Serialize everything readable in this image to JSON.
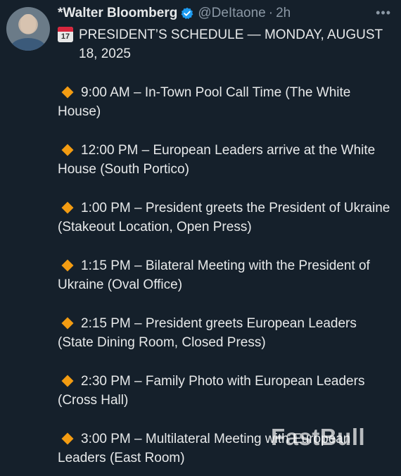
{
  "tweet": {
    "author_name": "*Walter Bloomberg",
    "handle": "@DeItaone",
    "separator": "·",
    "time": "2h",
    "more_label": "•••",
    "calendar_number": "17",
    "title": "PRESIDENT’S SCHEDULE — MONDAY, AUGUST 18, 2025",
    "items": [
      {
        "text": "9:00 AM – In-Town Pool Call Time (The White House)"
      },
      {
        "text": "12:00 PM – European Leaders arrive at the White House (South Portico)"
      },
      {
        "text": "1:00 PM – President greets the President of Ukraine (Stakeout Location, Open Press)"
      },
      {
        "text": "1:15 PM – Bilateral Meeting with the President of Ukraine (Oval Office)"
      },
      {
        "text": "2:15 PM – President greets European Leaders (State Dining Room, Closed Press)"
      },
      {
        "text": "2:30 PM – Family Photo with European Leaders (Cross Hall)"
      },
      {
        "text": "3:00 PM – Multilateral Meeting with European Leaders (East Room)"
      }
    ],
    "watermark": "FastBull",
    "colors": {
      "background": "#15202b",
      "text": "#e7e9ea",
      "muted": "#8b98a5",
      "verified": "#1d9bf0",
      "diamond": "#f39c12"
    },
    "icons": {
      "verified": "verified-badge-icon",
      "calendar": "calendar-icon",
      "bullet": "orange-diamond-icon",
      "more": "more-icon"
    }
  }
}
